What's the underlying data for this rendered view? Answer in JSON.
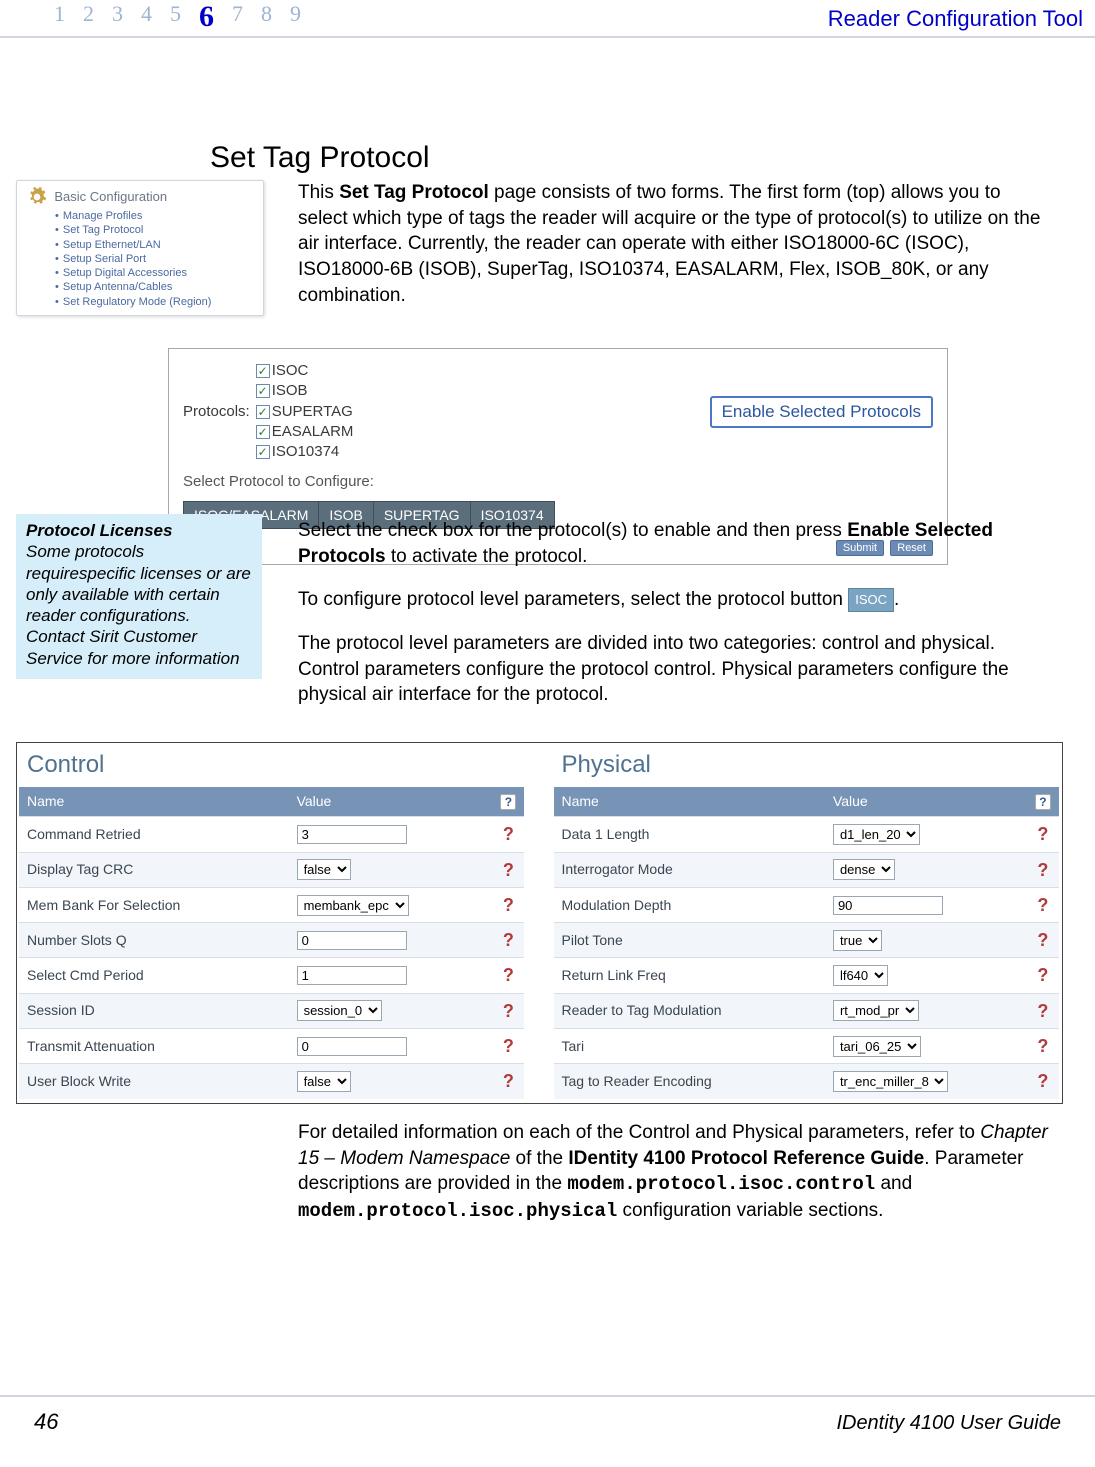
{
  "header": {
    "nums": [
      "1",
      "2",
      "3",
      "4",
      "5",
      "6",
      "7",
      "8",
      "9"
    ],
    "active_index": 5,
    "title": "Reader Configuration Tool"
  },
  "heading": "Set Tag Protocol",
  "side_card": {
    "title": "Basic Configuration",
    "items": [
      "Manage Profiles",
      "Set Tag Protocol",
      "Setup Ethernet/LAN",
      "Setup Serial Port",
      "Setup Digital Accessories",
      "Setup Antenna/Cables",
      "Set Regulatory Mode (Region)"
    ]
  },
  "intro": {
    "lead": "This ",
    "bold": "Set Tag Protocol",
    "rest": " page consists of two forms. The first form (top) allows you to select which type of tags the reader will acquire or the type of protocol(s) to utilize on the air interface. Currently, the reader can operate with either ISO18000-6C (ISOC), ISO18000-6B (ISOB), SuperTag, ISO10374, EASALARM, Flex, ISOB_80K, or any combination."
  },
  "proto_box": {
    "label": "Protocols:",
    "options": [
      "ISOC",
      "ISOB",
      "SUPERTAG",
      "EASALARM",
      "ISO10374"
    ],
    "enable_btn": "Enable Selected Protocols",
    "select_label": "Select Protocol to Configure:",
    "tabs": [
      "ISOC/EASALARM",
      "ISOB",
      "SUPERTAG",
      "ISO10374"
    ],
    "submit": "Submit",
    "reset": "Reset"
  },
  "callout": {
    "title": "Protocol Licenses",
    "body": "Some protocols requirespecific licenses or are only available with certain reader configurations. Contact Sirit Customer Service for more information"
  },
  "mid": {
    "p1a": "Select the check box for the protocol(s) to enable and then press ",
    "p1b": "Enable Selected Protocols",
    "p1c": " to activate the protocol.",
    "p2a": "To configure protocol level parameters, select the protocol button ",
    "p2chip": "ISOC",
    "p2b": ".",
    "p3": "The protocol level parameters are divided into two categories: control and physical. Control parameters configure the protocol control. Physical parameters configure the physical air interface for the protocol."
  },
  "panels": {
    "left": {
      "title": "Control",
      "cols": [
        "Name",
        "Value"
      ],
      "rows": [
        {
          "name": "Command Retried",
          "type": "text",
          "value": "3"
        },
        {
          "name": "Display Tag CRC",
          "type": "select",
          "value": "false"
        },
        {
          "name": "Mem Bank For Selection",
          "type": "select",
          "value": "membank_epc"
        },
        {
          "name": "Number Slots Q",
          "type": "text",
          "value": "0"
        },
        {
          "name": "Select Cmd Period",
          "type": "text",
          "value": "1"
        },
        {
          "name": "Session ID",
          "type": "select",
          "value": "session_0"
        },
        {
          "name": "Transmit Attenuation",
          "type": "text",
          "value": "0"
        },
        {
          "name": "User Block Write",
          "type": "select",
          "value": "false"
        }
      ]
    },
    "right": {
      "title": "Physical",
      "cols": [
        "Name",
        "Value"
      ],
      "rows": [
        {
          "name": "Data 1 Length",
          "type": "select",
          "value": "d1_len_20"
        },
        {
          "name": "Interrogator Mode",
          "type": "select",
          "value": "dense"
        },
        {
          "name": "Modulation Depth",
          "type": "text",
          "value": "90"
        },
        {
          "name": "Pilot Tone",
          "type": "select",
          "value": "true"
        },
        {
          "name": "Return Link Freq",
          "type": "select",
          "value": "lf640"
        },
        {
          "name": "Reader to Tag Modulation",
          "type": "select",
          "value": "rt_mod_pr"
        },
        {
          "name": "Tari",
          "type": "select",
          "value": "tari_06_25"
        },
        {
          "name": "Tag to Reader Encoding",
          "type": "select",
          "value": "tr_enc_miller_8"
        }
      ]
    }
  },
  "bottom": {
    "t1": "For detailed information on each of the Control and Physical parameters, refer to ",
    "ital": "Chapter 15 – Modem Namespace",
    "t2": " of the ",
    "bold1": "IDentity 4100 Protocol Reference Guide",
    "t3": ".  Parameter descriptions are provided in the ",
    "mono1": "modem.protocol.isoc.control",
    "t4": " and ",
    "mono2": "modem.protocol.isoc.physical",
    "t5": " configuration variable sections."
  },
  "footer": {
    "page": "46",
    "guide": "IDentity 4100 User Guide"
  }
}
